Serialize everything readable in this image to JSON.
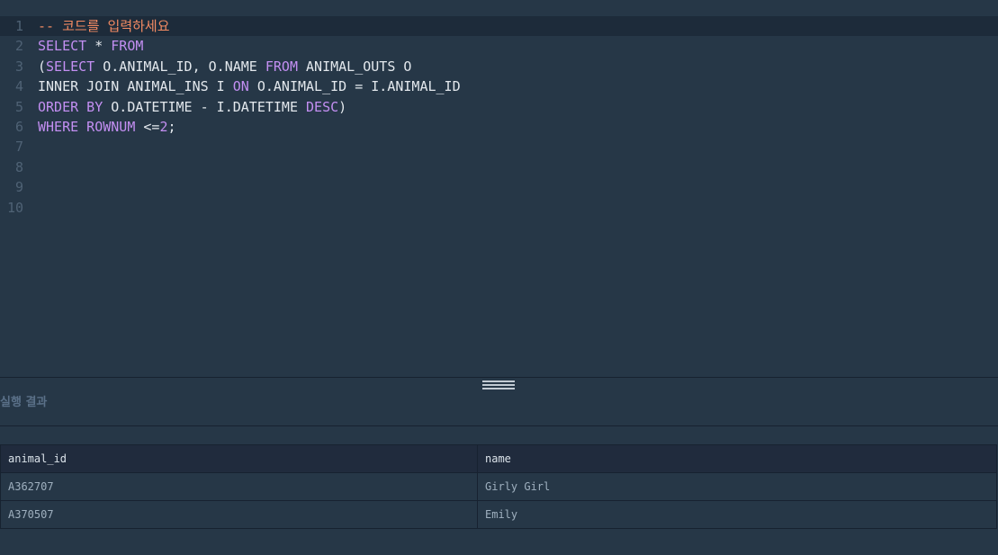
{
  "editor": {
    "line_numbers": [
      "1",
      "2",
      "3",
      "4",
      "5",
      "6",
      "7",
      "8",
      "9",
      "10"
    ],
    "lines": [
      [
        {
          "t": "comment",
          "v": "-- 코드를 입력하세요"
        }
      ],
      [
        {
          "t": "kw",
          "v": "SELECT"
        },
        {
          "t": "plain",
          "v": " * "
        },
        {
          "t": "kw",
          "v": "FROM"
        }
      ],
      [
        {
          "t": "plain",
          "v": "("
        },
        {
          "t": "kw",
          "v": "SELECT"
        },
        {
          "t": "plain",
          "v": " O.ANIMAL_ID, O.NAME "
        },
        {
          "t": "kw",
          "v": "FROM"
        },
        {
          "t": "plain",
          "v": " ANIMAL_OUTS O"
        }
      ],
      [
        {
          "t": "plain",
          "v": "INNER JOIN ANIMAL_INS I "
        },
        {
          "t": "kw",
          "v": "ON"
        },
        {
          "t": "plain",
          "v": " O.ANIMAL_ID = I.ANIMAL_ID"
        }
      ],
      [
        {
          "t": "kw",
          "v": "ORDER BY"
        },
        {
          "t": "plain",
          "v": " O.DATETIME - I.DATETIME "
        },
        {
          "t": "kw",
          "v": "DESC"
        },
        {
          "t": "plain",
          "v": ")"
        }
      ],
      [
        {
          "t": "kw",
          "v": "WHERE ROWNUM"
        },
        {
          "t": "plain",
          "v": " <="
        },
        {
          "t": "num",
          "v": "2"
        },
        {
          "t": "plain",
          "v": ";"
        }
      ],
      [],
      [],
      [],
      []
    ],
    "active_line": 1
  },
  "result": {
    "title": "실행 결과",
    "columns": [
      "animal_id",
      "name"
    ],
    "rows": [
      [
        "A362707",
        "Girly Girl"
      ],
      [
        "A370507",
        "Emily"
      ]
    ]
  },
  "colors": {
    "background": "#263747",
    "comment": "#f48b63",
    "keyword": "#c38ff2",
    "text": "#e3e8ed"
  }
}
